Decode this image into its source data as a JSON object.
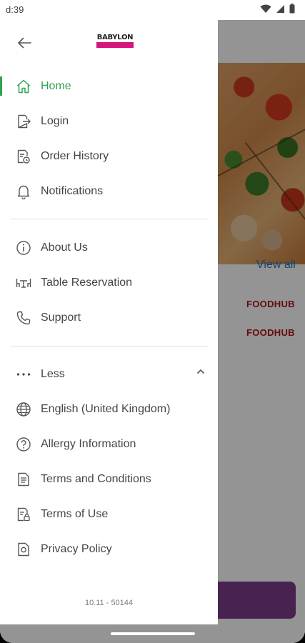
{
  "status_bar": {
    "time": "d:39"
  },
  "background": {
    "view_all": "View all",
    "brand_1": "FOODHUB",
    "brand_2": "FOODHUB"
  },
  "drawer": {
    "logo": "BABYLON",
    "main_menu": [
      {
        "label": "Home",
        "icon": "home-icon",
        "active": true
      },
      {
        "label": "Login",
        "icon": "login-icon"
      },
      {
        "label": "Order History",
        "icon": "receipt-icon"
      },
      {
        "label": "Notifications",
        "icon": "bell-icon"
      }
    ],
    "info_menu": [
      {
        "label": "About Us",
        "icon": "info-icon"
      },
      {
        "label": "Table Reservation",
        "icon": "table-icon"
      },
      {
        "label": "Support",
        "icon": "phone-icon"
      }
    ],
    "less_label": "Less",
    "more_menu": [
      {
        "label": "English (United Kingdom)",
        "icon": "globe-icon"
      },
      {
        "label": "Allergy Information",
        "icon": "help-circle-icon"
      },
      {
        "label": "Terms and Conditions",
        "icon": "document-icon"
      },
      {
        "label": "Terms of Use",
        "icon": "document-lock-icon"
      },
      {
        "label": "Privacy Policy",
        "icon": "privacy-icon"
      }
    ],
    "version": "10.11 - 50144"
  },
  "colors": {
    "accent": "#2ea44f",
    "brand_band": "#d4157a",
    "link": "#1f74c9",
    "cta": "#7d3d8a"
  }
}
